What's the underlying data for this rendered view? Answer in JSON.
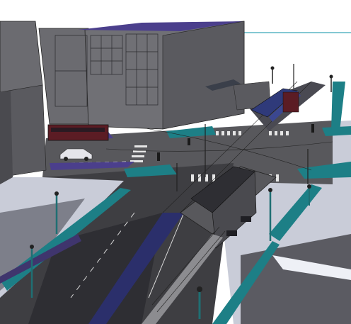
{
  "scene": {
    "type": "3d-street-model-render",
    "colors": {
      "sky": "#ffffff",
      "horizon_line": "#3aa6b9",
      "building_dark": "#4a4a4f",
      "building_mid": "#6b6b70",
      "building_light": "#8c8c90",
      "roof_accent": "#4b3f8c",
      "road_dark": "#3e3e42",
      "road_mid": "#58585c",
      "sidewalk_light": "#c9ccd8",
      "sidewalk_shadow": "#7d7f8a",
      "teal_planting": "#1d7f86",
      "bus_lane": "#2b2f6b",
      "bus_red": "#5b1c24",
      "tram_blue": "#2f3a7a",
      "crosswalk": "#e6e6e6",
      "lamp_post": "#1f6f73"
    },
    "icons": [
      "street-lamp-icon",
      "traffic-signal-icon",
      "tram-icon",
      "bus-icon",
      "car-icon",
      "bench-icon"
    ]
  }
}
